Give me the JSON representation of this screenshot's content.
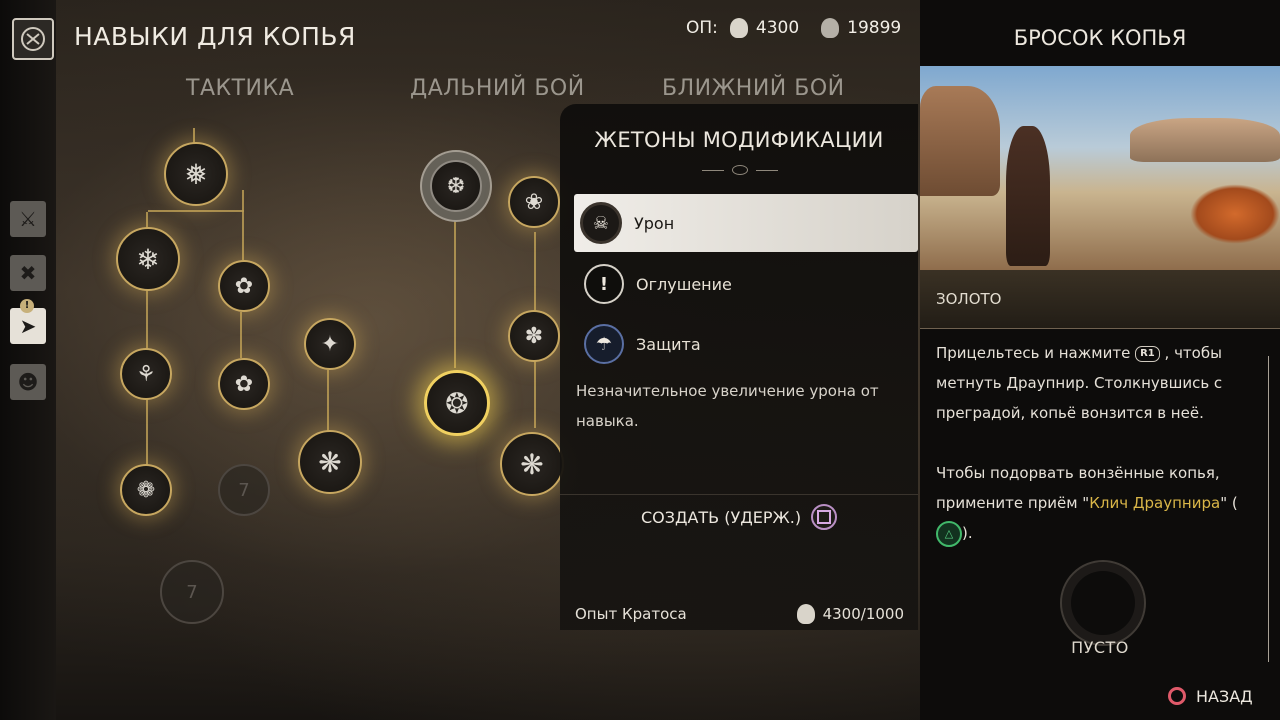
{
  "header": {
    "title": "НАВЫКИ ДЛЯ КОПЬЯ",
    "xp_label": "ОП:",
    "xp_spear": "4300",
    "xp_total": "19899"
  },
  "tabs": [
    {
      "label": "ТАКТИКА"
    },
    {
      "label": "ДАЛЬНИЙ БОЙ"
    },
    {
      "label": "БЛИЖНИЙ БОЙ"
    }
  ],
  "tree": {
    "locked_level": "7"
  },
  "modifiers": {
    "title": "ЖЕТОНЫ МОДИФИКАЦИИ",
    "options": [
      {
        "label": "Урон",
        "icon": "skull-icon"
      },
      {
        "label": "Оглушение",
        "icon": "exclamation-icon"
      },
      {
        "label": "Защита",
        "icon": "shield-icon"
      }
    ],
    "description": "Незначительное увеличение урона от навыка.",
    "create_label": "СОЗДАТЬ (УДЕРЖ.)",
    "kratos_label": "Опыт Кратоса",
    "kratos_value": "4300/1000"
  },
  "detail": {
    "title": "БРОСОК КОПЬЯ",
    "tier": "ЗОЛОТО",
    "desc1_a": "Прицельтесь и нажмите",
    "desc1_btn": "R1",
    "desc1_b": ", чтобы метнуть Драупнир. Столкнувшись с преградой, копьё вонзится в неё.",
    "desc2_a": "Чтобы подорвать вонзённые копья, примените приём \"",
    "desc2_gold": "Клич Драупнира",
    "desc2_b": "\" (",
    "desc2_c": ").",
    "slot_label": "ПУСТО",
    "back_label": "НАЗАД"
  }
}
